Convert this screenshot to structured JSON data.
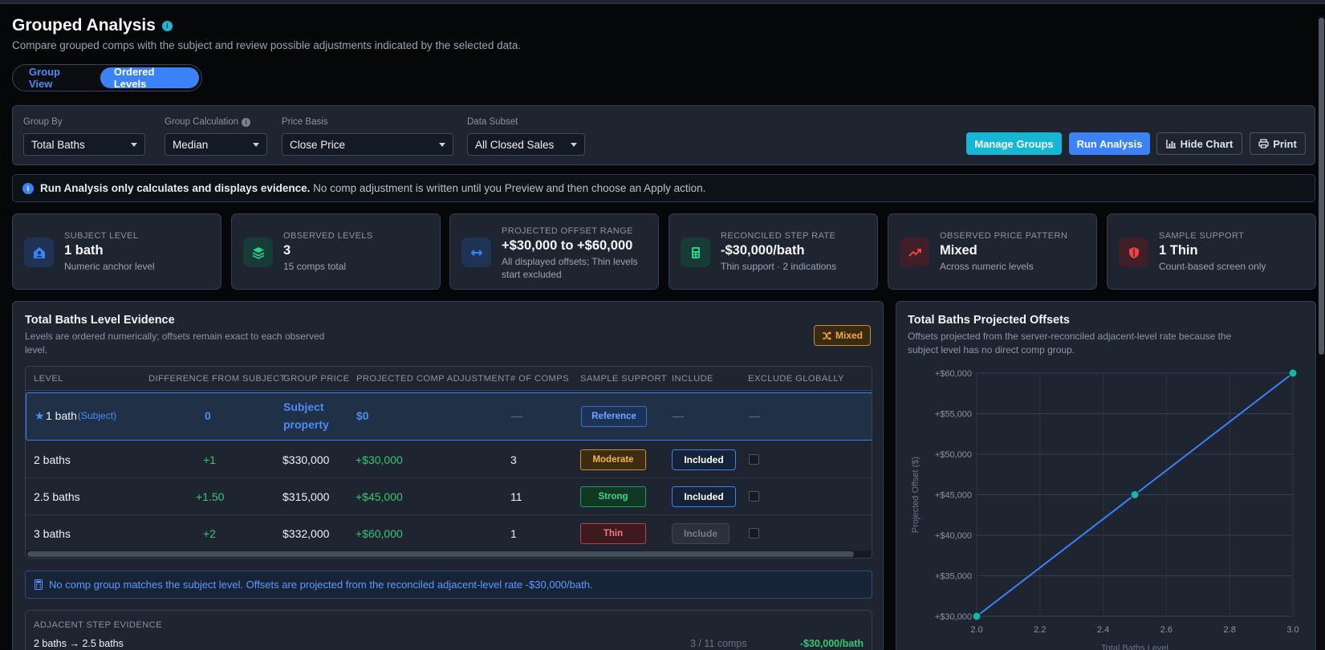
{
  "header": {
    "title": "Grouped Analysis",
    "info_icon": "i",
    "subtitle": "Compare grouped comps with the subject and review possible adjustments indicated by the selected data."
  },
  "view_toggle": {
    "options": [
      "Group View",
      "Ordered Levels"
    ],
    "active": "Ordered Levels"
  },
  "controls": {
    "group_by": {
      "label": "Group By",
      "value": "Total Baths"
    },
    "group_calc": {
      "label": "Group Calculation",
      "value": "Median"
    },
    "price_basis": {
      "label": "Price Basis",
      "value": "Close Price"
    },
    "data_subset": {
      "label": "Data Subset",
      "value": "All Closed Sales"
    },
    "buttons": {
      "manage": "Manage Groups",
      "run": "Run Analysis",
      "hide_chart": "Hide Chart",
      "print": "Print"
    }
  },
  "notice": {
    "bold": "Run Analysis only calculates and displays evidence.",
    "text": "No comp adjustment is written until you Preview and then choose an Apply action."
  },
  "cards": [
    {
      "title": "SUBJECT LEVEL",
      "value": "1 bath",
      "sub": "Numeric anchor level",
      "icon": "home-user-icon",
      "color": "#3b82f6"
    },
    {
      "title": "OBSERVED LEVELS",
      "value": "3",
      "sub": "15 comps total",
      "icon": "layers-icon",
      "color": "#2bd08a"
    },
    {
      "title": "PROJECTED OFFSET RANGE",
      "value": "+$30,000 to +$60,000",
      "sub": "All displayed offsets; Thin levels start excluded",
      "icon": "arrows-horizontal-icon",
      "color": "#3b82f6"
    },
    {
      "title": "RECONCILED STEP RATE",
      "value": "-$30,000/bath",
      "sub": "Thin support · 2 indications",
      "icon": "calculator-icon",
      "color": "#2bd08a"
    },
    {
      "title": "OBSERVED PRICE PATTERN",
      "value": "Mixed",
      "sub": "Across numeric levels",
      "icon": "trend-up-icon",
      "color": "#ef4444"
    },
    {
      "title": "SAMPLE SUPPORT",
      "value": "1 Thin",
      "sub": "Count-based screen only",
      "icon": "shield-icon",
      "color": "#ef4444"
    }
  ],
  "evidence": {
    "title": "Total Baths Level Evidence",
    "subtitle": "Levels are ordered numerically; offsets remain exact to each observed level.",
    "pattern_badge": "Mixed",
    "columns": [
      "LEVEL",
      "DIFFERENCE FROM SUBJECT",
      "GROUP PRICE",
      "PROJECTED COMP ADJUSTMENT",
      "# OF COMPS",
      "SAMPLE SUPPORT",
      "INCLUDE",
      "EXCLUDE GLOBALLY"
    ],
    "subject_row": {
      "star": "★",
      "level": "1 bath",
      "tag": "(Subject)",
      "diff": "0",
      "price_line1": "Subject",
      "price_line2": "property",
      "adjustment": "$0",
      "comps": "—",
      "support": "Reference",
      "include": "—",
      "exclude": "—"
    },
    "rows": [
      {
        "level": "2 baths",
        "diff": "+1",
        "price": "$330,000",
        "adjustment": "+$30,000",
        "comps": "3",
        "support": "Moderate",
        "include": "Included"
      },
      {
        "level": "2.5 baths",
        "diff": "+1.50",
        "price": "$315,000",
        "adjustment": "+$45,000",
        "comps": "11",
        "support": "Strong",
        "include": "Included"
      },
      {
        "level": "3 baths",
        "diff": "+2",
        "price": "$332,000",
        "adjustment": "+$60,000",
        "comps": "1",
        "support": "Thin",
        "include": "Include"
      }
    ],
    "no_match": "No comp group matches the subject level. Offsets are projected from the reconciled adjacent-level rate -$30,000/bath.",
    "adjacent": {
      "title": "ADJACENT STEP EVIDENCE",
      "row_label": "2 baths → 2.5 baths",
      "row_comps": "3 / 11 comps",
      "row_value": "-$30,000/bath"
    }
  },
  "chart_panel": {
    "title": "Total Baths Projected Offsets",
    "subtitle": "Offsets projected from the server-reconciled adjacent-level rate because the subject level has no direct comp group."
  },
  "chart_data": {
    "type": "line",
    "title": "Total Baths Projected Offsets",
    "xlabel": "Total Baths Level",
    "ylabel": "Projected Offset ($)",
    "x": [
      2.0,
      2.5,
      3.0
    ],
    "series": [
      {
        "values": [
          30000,
          45000,
          60000
        ]
      }
    ],
    "xlim": [
      2.0,
      3.0
    ],
    "ylim": [
      30000,
      60000
    ],
    "xticks": [
      "2.0",
      "2.2",
      "2.4",
      "2.6",
      "2.8",
      "3.0"
    ],
    "yticks": [
      "+$30,000",
      "+$35,000",
      "+$40,000",
      "+$45,000",
      "+$50,000",
      "+$55,000",
      "+$60,000"
    ],
    "grid": true,
    "line_color": "#3b82f6",
    "point_color": "#14b8a6"
  }
}
